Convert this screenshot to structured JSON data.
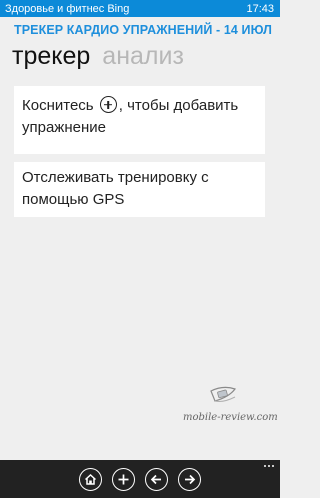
{
  "status_bar": {
    "app_name": "Здоровье и фитнес Bing",
    "time": "17:43"
  },
  "header": {
    "title": "ТРЕКЕР КАРДИО УПРАЖНЕНИЙ - 14 ИЮЛ"
  },
  "pivots": [
    {
      "label": "трекер",
      "active": true
    },
    {
      "label": "анализ",
      "active": false
    }
  ],
  "cards": {
    "add_exercise": {
      "text_before": "Коснитесь",
      "text_after": ", чтобы добавить упражнение",
      "icon": "plus-circle-icon"
    },
    "gps": {
      "text": "Отслеживать тренировку с помощью GPS"
    }
  },
  "watermark": {
    "text": "mobile-review.com"
  },
  "app_bar": {
    "buttons": [
      {
        "name": "home-button",
        "icon": "home-icon"
      },
      {
        "name": "add-button",
        "icon": "plus-icon"
      },
      {
        "name": "back-button",
        "icon": "arrow-left-icon"
      },
      {
        "name": "forward-button",
        "icon": "arrow-right-icon"
      }
    ]
  },
  "colors": {
    "accent": "#1e8fdc",
    "status_bar": "#0c8ad8",
    "app_bar": "#222222",
    "background": "#efefef"
  }
}
